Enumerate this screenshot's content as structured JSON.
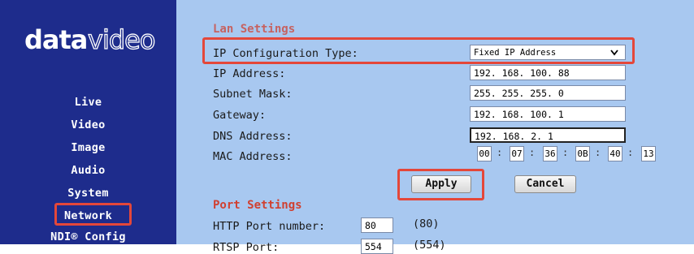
{
  "brand": {
    "logo_prefix": "data",
    "logo_suffix": "video"
  },
  "nav": {
    "live": "Live",
    "video": "Video",
    "image": "Image",
    "audio": "Audio",
    "system": "System",
    "network": "Network",
    "ndi_config": "NDI® Config"
  },
  "lan": {
    "section_title": "Lan Settings",
    "ip_config_type_label": "IP Configuration Type:",
    "ip_config_type_value": "Fixed IP Address",
    "ip_address_label": "IP Address:",
    "ip_address_value": "192. 168. 100. 88",
    "subnet_label": "Subnet Mask:",
    "subnet_value": "255. 255. 255. 0",
    "gateway_label": "Gateway:",
    "gateway_value": "192. 168. 100. 1",
    "dns_label": "DNS Address:",
    "dns_value": "192. 168. 2. 1",
    "mac_label": "MAC Address:",
    "mac": [
      "00",
      "07",
      "36",
      "0B",
      "40",
      "13"
    ]
  },
  "buttons": {
    "apply": "Apply",
    "cancel": "Cancel"
  },
  "port": {
    "section_title": "Port Settings",
    "http_label": "HTTP Port number:",
    "http_value": "80",
    "http_default": "(80)",
    "rtsp_label": "RTSP Port:",
    "rtsp_value": "554",
    "rtsp_default": "(554)"
  },
  "colors": {
    "sidebar": "#1e2c8c",
    "content": "#a8c8f0",
    "highlight": "#e4473a",
    "section_title": "#d04030"
  }
}
